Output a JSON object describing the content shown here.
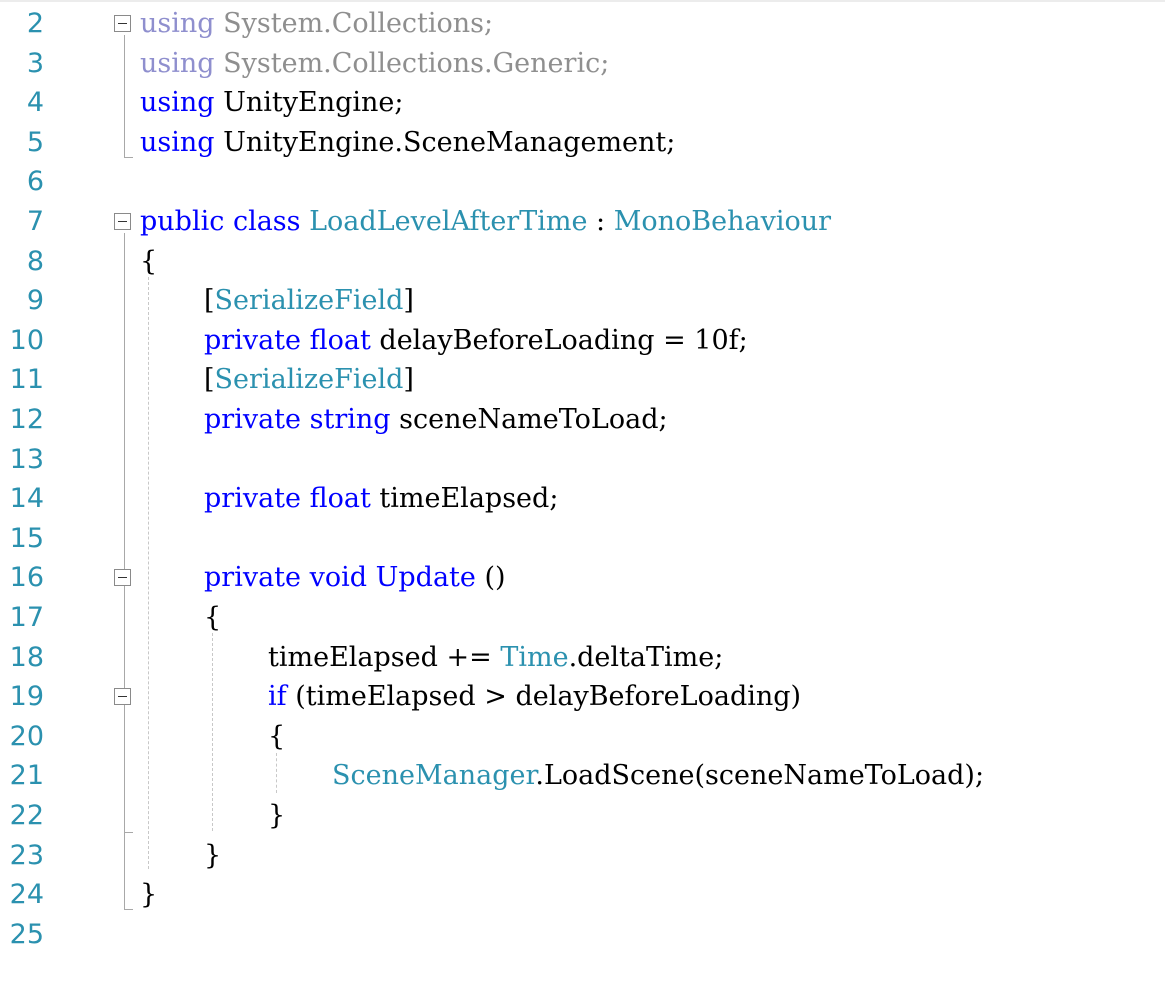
{
  "editor": {
    "lines": [
      {
        "num": "2",
        "indent": 0,
        "tokens": [
          {
            "t": "using",
            "c": "dim"
          },
          {
            "t": " System.Collections;",
            "c": "dimp"
          }
        ]
      },
      {
        "num": "3",
        "indent": 0,
        "tokens": [
          {
            "t": "using",
            "c": "dim"
          },
          {
            "t": " System.Collections.Generic;",
            "c": "dimp"
          }
        ]
      },
      {
        "num": "4",
        "indent": 0,
        "tokens": [
          {
            "t": "using",
            "c": "kw"
          },
          {
            "t": " UnityEngine;",
            "c": "pl"
          }
        ]
      },
      {
        "num": "5",
        "indent": 0,
        "tokens": [
          {
            "t": "using",
            "c": "kw"
          },
          {
            "t": " UnityEngine.SceneManagement;",
            "c": "pl"
          }
        ]
      },
      {
        "num": "6",
        "indent": 0,
        "tokens": []
      },
      {
        "num": "7",
        "indent": 0,
        "tokens": [
          {
            "t": "public",
            "c": "kw"
          },
          {
            "t": " ",
            "c": "pl"
          },
          {
            "t": "class",
            "c": "kw"
          },
          {
            "t": " ",
            "c": "pl"
          },
          {
            "t": "LoadLevelAfterTime",
            "c": "typ"
          },
          {
            "t": " : ",
            "c": "pl"
          },
          {
            "t": "MonoBehaviour",
            "c": "typ"
          }
        ]
      },
      {
        "num": "8",
        "indent": 0,
        "tokens": [
          {
            "t": "{",
            "c": "pl"
          }
        ]
      },
      {
        "num": "9",
        "indent": 1,
        "tokens": [
          {
            "t": "[",
            "c": "pl"
          },
          {
            "t": "SerializeField",
            "c": "typ"
          },
          {
            "t": "]",
            "c": "pl"
          }
        ]
      },
      {
        "num": "10",
        "indent": 1,
        "tokens": [
          {
            "t": "private",
            "c": "kw"
          },
          {
            "t": " ",
            "c": "pl"
          },
          {
            "t": "float",
            "c": "kw"
          },
          {
            "t": " delayBeforeLoading = 10f;",
            "c": "pl"
          }
        ]
      },
      {
        "num": "11",
        "indent": 1,
        "tokens": [
          {
            "t": "[",
            "c": "pl"
          },
          {
            "t": "SerializeField",
            "c": "typ"
          },
          {
            "t": "]",
            "c": "pl"
          }
        ]
      },
      {
        "num": "12",
        "indent": 1,
        "tokens": [
          {
            "t": "private",
            "c": "kw"
          },
          {
            "t": " ",
            "c": "pl"
          },
          {
            "t": "string",
            "c": "kw"
          },
          {
            "t": " sceneNameToLoad;",
            "c": "pl"
          }
        ]
      },
      {
        "num": "13",
        "indent": 1,
        "tokens": []
      },
      {
        "num": "14",
        "indent": 1,
        "tokens": [
          {
            "t": "private",
            "c": "kw"
          },
          {
            "t": " ",
            "c": "pl"
          },
          {
            "t": "float",
            "c": "kw"
          },
          {
            "t": " timeElapsed;",
            "c": "pl"
          }
        ]
      },
      {
        "num": "15",
        "indent": 1,
        "tokens": []
      },
      {
        "num": "16",
        "indent": 1,
        "tokens": [
          {
            "t": "private",
            "c": "kw"
          },
          {
            "t": " ",
            "c": "pl"
          },
          {
            "t": "void",
            "c": "kw"
          },
          {
            "t": " ",
            "c": "pl"
          },
          {
            "t": "Update",
            "c": "kw"
          },
          {
            "t": " ()",
            "c": "pl"
          }
        ]
      },
      {
        "num": "17",
        "indent": 1,
        "tokens": [
          {
            "t": "{",
            "c": "pl"
          }
        ]
      },
      {
        "num": "18",
        "indent": 2,
        "tokens": [
          {
            "t": "timeElapsed += ",
            "c": "pl"
          },
          {
            "t": "Time",
            "c": "typ"
          },
          {
            "t": ".deltaTime;",
            "c": "pl"
          }
        ]
      },
      {
        "num": "19",
        "indent": 2,
        "tokens": [
          {
            "t": "if",
            "c": "kw"
          },
          {
            "t": " (timeElapsed > delayBeforeLoading)",
            "c": "pl"
          }
        ]
      },
      {
        "num": "20",
        "indent": 2,
        "tokens": [
          {
            "t": "{",
            "c": "pl"
          }
        ]
      },
      {
        "num": "21",
        "indent": 3,
        "tokens": [
          {
            "t": "SceneManager",
            "c": "typ"
          },
          {
            "t": ".LoadScene(sceneNameToLoad);",
            "c": "pl"
          }
        ]
      },
      {
        "num": "22",
        "indent": 2,
        "tokens": [
          {
            "t": "}",
            "c": "pl"
          }
        ]
      },
      {
        "num": "23",
        "indent": 1,
        "tokens": [
          {
            "t": "}",
            "c": "pl"
          }
        ]
      },
      {
        "num": "24",
        "indent": 0,
        "tokens": [
          {
            "t": "}",
            "c": "pl"
          }
        ]
      },
      {
        "num": "25",
        "indent": 0,
        "tokens": []
      }
    ],
    "fold_markers": [
      "2",
      "7",
      "16",
      "19"
    ],
    "colors": {
      "keyword": "#0000ff",
      "type": "#2b91af",
      "plain": "#000000",
      "dimmed_keyword": "#8f8fce",
      "dimmed_text": "#8f8f8f",
      "line_number": "#2b91af"
    }
  }
}
